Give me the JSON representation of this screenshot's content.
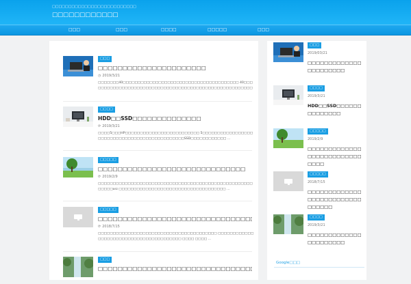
{
  "header": {
    "tagline": "□□□□□□□□□□□□□□□□□□□□□□□□□□",
    "title": "□□□□□□□□□□□□"
  },
  "nav": [
    "□□□",
    "□□□",
    "□□□□",
    "□□□□□",
    "□□□"
  ],
  "posts": [
    {
      "category": "□□□",
      "title": "□□□□□□□□□□□□□□□□□□□□□□",
      "date_icon": "clock-icon",
      "date": "2019/3/21",
      "excerpt": "□□□□□□□40□□□□□□□□□□□□□□□□□□□□□□□□□□□□□□□□□□□□□□□ 40□□□□□□□□□□□□□□□□□□□□□□□□□□□□□□□□□□□□□□□□□□□□□□□□□□□□□□□□□□□□ ..."
    },
    {
      "category": "□□□□",
      "title": "HDD□□SSD□□□□□□□□□□□□□□",
      "date_icon": "refresh-icon",
      "date": "2019/3/21",
      "excerpt": "□□□□5□□□HP□□□□□□□□□□□□□□□□□□□□□□□□□ 5□□□□□□□□□□□□□□□□□□□□□□□□□□□□□□□□□□□□□□□□□□□□□□SSD□□□□□□□□□□□□ ..."
    },
    {
      "category": "□□□□□",
      "title": "□□□□□□□□□□□□□□□□□□□□□□□□□□□□□□",
      "date_icon": "refresh-icon",
      "date": "2019/2/9",
      "excerpt": "□□□□□□□□□□□□□□□□□□□□□□□□□□□□□□□□□□□□□□□□□□□□□□□□□□□□□□□□□orz □□□□□□□□□□□□□□□□□□□□□□□□□□□□□□□□□□□□ ..."
    },
    {
      "category": "□□□□□",
      "title": "□□□□□□□□□□□□□□□□□□□□□□□□□□□□□□□□",
      "date_icon": "refresh-icon",
      "date": "2018/7/15",
      "excerpt": "□□□□□□□□□□□□□□□□□□□□□□□□□□□□□□□□□□□□□□□□ □□□□□□□□□□□□□□□□□□□□□□□□□□□□□□□□□□□□□□□□ □□□□ □□□□ ..."
    },
    {
      "category": "□□□",
      "title": "□□□□□□□□□□□□□□□□□□□□□□□□□□□□□□□□",
      "date_icon": "",
      "date": "",
      "excerpt": ""
    }
  ],
  "sidebar": {
    "posts": [
      {
        "category": "□□□",
        "date": "2019/03/21",
        "title": "□□□□□□□□□□□□□□□□□□□□□□"
      },
      {
        "category": "□□□□",
        "date": "2019/3/21",
        "title": "HDD□□SSD□□□□□□□□□□□□□□"
      },
      {
        "category": "□□□□□",
        "date": "2019/2/9",
        "title": "□□□□□□□□□□□□□□□□□□□□□□□□□□□□□□"
      },
      {
        "category": "□□□□□",
        "date": "2018/7/15",
        "title": "□□□□□□□□□□□□□□□□□□□□□□□□□□□□□□□□"
      },
      {
        "category": "□□□□",
        "date": "2019/3/21",
        "title": "□□□□□□□□□□□□□□□□□□□□□□"
      }
    ],
    "google_label": "Google□□□"
  },
  "colors": {
    "header": "#0aa2ec",
    "accent": "#1a9ee3",
    "background": "#f1f2f3"
  }
}
